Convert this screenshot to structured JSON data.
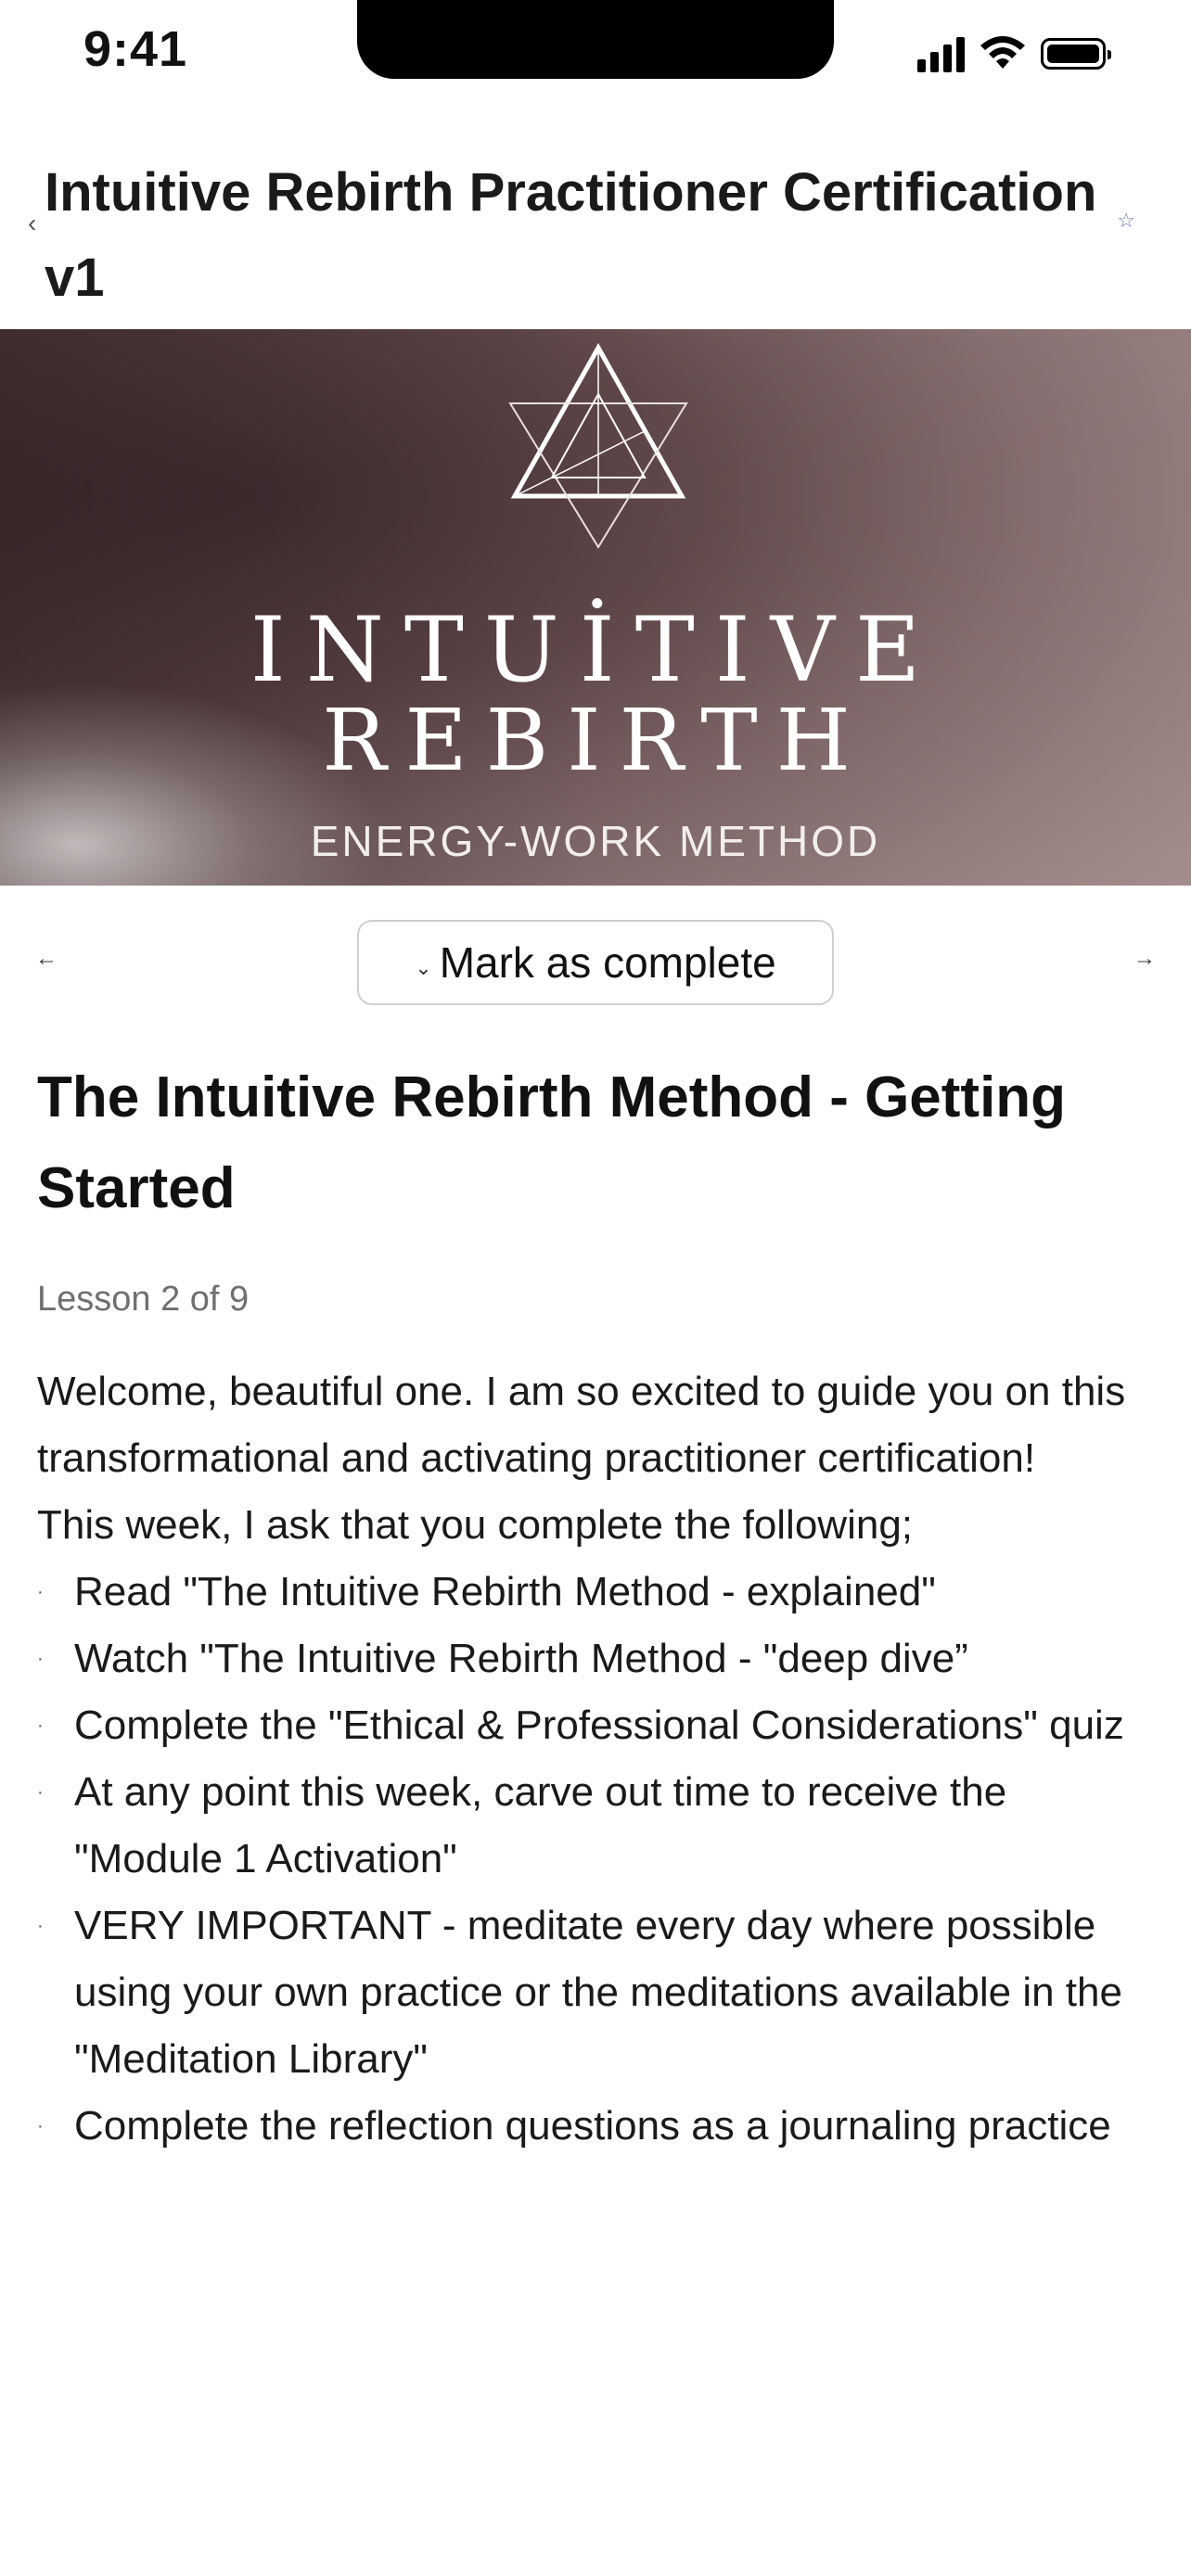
{
  "status_bar": {
    "time": "9:41"
  },
  "header": {
    "title": "Intuitive Rebirth Practitioner Certification v1",
    "back_glyph": "‹",
    "star_glyph": "☆"
  },
  "hero": {
    "line1": "INTUİTIVE",
    "line2": "REBIRTH",
    "line3": "ENERGY-WORK METHOD"
  },
  "lesson_nav": {
    "prev_glyph": "←",
    "next_glyph": "→",
    "check_glyph": "⌄",
    "complete_label": "Mark as complete"
  },
  "lesson": {
    "title": "The Intuitive Rebirth Method - Getting Started",
    "count": "Lesson 2 of 9",
    "intro": "Welcome, beautiful one. I am so excited to guide you on this transformational and activating practitioner certification!",
    "lead": "This week, I ask that you complete the following;",
    "bullet_glyph": "·",
    "items": [
      "Read \"The Intuitive Rebirth Method - explained\"",
      "Watch \"The Intuitive Rebirth Method - \"deep dive”",
      "Complete the \"Ethical & Professional Considerations\" quiz",
      "At any point this week, carve out time to receive the \"Module 1 Activation\"",
      "VERY IMPORTANT - meditate every day where possible using your own practice or the meditations available in the \"Meditation Library\"",
      "Complete the reflection questions as a journaling practice"
    ]
  },
  "icons": {
    "back": "chevron-left-icon",
    "favorite": "star-icon",
    "prev": "arrow-left-icon",
    "next": "arrow-right-icon",
    "check": "check-icon",
    "logo": "triangle-logo-icon"
  }
}
